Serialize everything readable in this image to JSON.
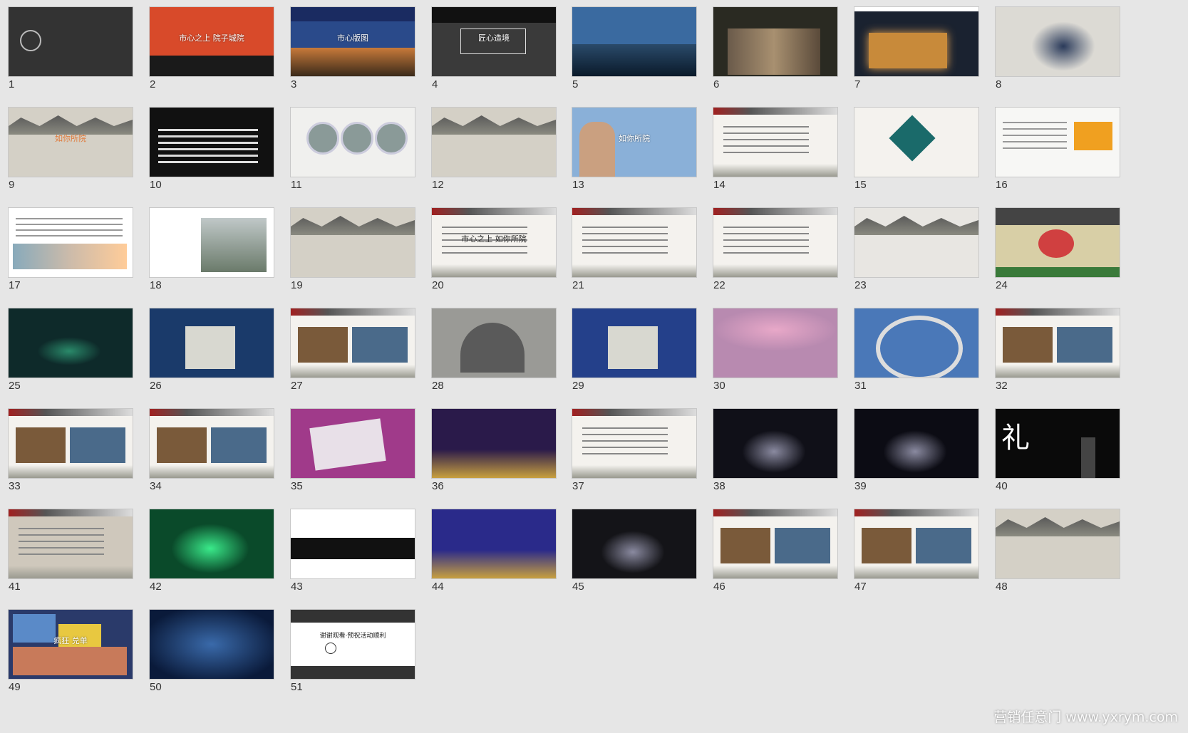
{
  "slides": [
    {
      "n": "1",
      "kind": "dark",
      "bg": "#333333",
      "title": ""
    },
    {
      "n": "2",
      "kind": "red",
      "bg": "#d84a2a",
      "title": "市心之上 院子城院"
    },
    {
      "n": "3",
      "kind": "city",
      "bg": "#2a4a8a",
      "title": "市心版图"
    },
    {
      "n": "4",
      "kind": "bw",
      "bg": "#3a3a3a",
      "title": "匠心造境"
    },
    {
      "n": "5",
      "kind": "sky",
      "bg": "#3a6aa0",
      "title": ""
    },
    {
      "n": "6",
      "kind": "people",
      "bg": "#2a2a22",
      "title": ""
    },
    {
      "n": "7",
      "kind": "house",
      "bg": "#1a2230",
      "title": ""
    },
    {
      "n": "8",
      "kind": "ink",
      "bg": "#dcdad4",
      "title": ""
    },
    {
      "n": "9",
      "kind": "wall",
      "bg": "#d4d0c6",
      "title": "如你所院"
    },
    {
      "n": "10",
      "kind": "black",
      "bg": "#111111",
      "title": ""
    },
    {
      "n": "11",
      "kind": "circles",
      "bg": "#f0f0ee",
      "title": ""
    },
    {
      "n": "12",
      "kind": "wall",
      "bg": "#d4d0c6",
      "title": ""
    },
    {
      "n": "13",
      "kind": "child",
      "bg": "#8ab0d8",
      "title": "如你所院"
    },
    {
      "n": "14",
      "kind": "doc",
      "bg": "#f4f2ee",
      "title": ""
    },
    {
      "n": "15",
      "kind": "diagram",
      "bg": "#f4f2ee",
      "title": ""
    },
    {
      "n": "16",
      "kind": "doc2",
      "bg": "#f7f7f5",
      "title": ""
    },
    {
      "n": "17",
      "kind": "doc3",
      "bg": "#ffffff",
      "title": ""
    },
    {
      "n": "18",
      "kind": "doc4",
      "bg": "#ffffff",
      "title": ""
    },
    {
      "n": "19",
      "kind": "wall",
      "bg": "#d4d0c6",
      "title": ""
    },
    {
      "n": "20",
      "kind": "doc",
      "bg": "#f4f2ee",
      "title": "市心之上 如你所院"
    },
    {
      "n": "21",
      "kind": "doc",
      "bg": "#f4f2ee",
      "title": ""
    },
    {
      "n": "22",
      "kind": "doc",
      "bg": "#f4f2ee",
      "title": ""
    },
    {
      "n": "23",
      "kind": "inkscape",
      "bg": "#e8e6e2",
      "title": ""
    },
    {
      "n": "24",
      "kind": "plan",
      "bg": "#d8cfa6",
      "title": ""
    },
    {
      "n": "25",
      "kind": "stage-green",
      "bg": "#0e2a2a",
      "title": ""
    },
    {
      "n": "26",
      "kind": "stage-blue",
      "bg": "#1a3a6a",
      "title": ""
    },
    {
      "n": "27",
      "kind": "doc-photo",
      "bg": "#f4f2ee",
      "title": ""
    },
    {
      "n": "28",
      "kind": "render",
      "bg": "#9a9a96",
      "title": ""
    },
    {
      "n": "29",
      "kind": "stage-blue",
      "bg": "#24408a",
      "title": ""
    },
    {
      "n": "30",
      "kind": "blossom",
      "bg": "#b88ab0",
      "title": ""
    },
    {
      "n": "31",
      "kind": "tunnel",
      "bg": "#4a78b8",
      "title": ""
    },
    {
      "n": "32",
      "kind": "doc-photo",
      "bg": "#f4f2ee",
      "title": ""
    },
    {
      "n": "33",
      "kind": "doc-photo",
      "bg": "#f4f2ee",
      "title": ""
    },
    {
      "n": "34",
      "kind": "doc-photo",
      "bg": "#f4f2ee",
      "title": ""
    },
    {
      "n": "35",
      "kind": "magenta",
      "bg": "#a03a8a",
      "title": ""
    },
    {
      "n": "36",
      "kind": "stage-purple",
      "bg": "#2a1a4a",
      "title": ""
    },
    {
      "n": "37",
      "kind": "doc",
      "bg": "#f4f2ee",
      "title": ""
    },
    {
      "n": "38",
      "kind": "dark-stage",
      "bg": "#101018",
      "title": ""
    },
    {
      "n": "39",
      "kind": "dark-stage",
      "bg": "#0c0c14",
      "title": ""
    },
    {
      "n": "40",
      "kind": "li",
      "bg": "#0a0a0a",
      "title": "礼"
    },
    {
      "n": "41",
      "kind": "doc-dark",
      "bg": "#cfc8bc",
      "title": ""
    },
    {
      "n": "42",
      "kind": "green-stage",
      "bg": "#0a4a2a",
      "title": ""
    },
    {
      "n": "43",
      "kind": "doc-black",
      "bg": "#ffffff",
      "title": ""
    },
    {
      "n": "44",
      "kind": "stage-purple",
      "bg": "#2a2a8a",
      "title": ""
    },
    {
      "n": "45",
      "kind": "dark-stage",
      "bg": "#141418",
      "title": ""
    },
    {
      "n": "46",
      "kind": "doc-photo",
      "bg": "#f4f2ee",
      "title": ""
    },
    {
      "n": "47",
      "kind": "doc-photo",
      "bg": "#f4f2ee",
      "title": ""
    },
    {
      "n": "48",
      "kind": "wall",
      "bg": "#d4d0c6",
      "title": ""
    },
    {
      "n": "49",
      "kind": "collage",
      "bg": "#2a3a6a",
      "title": "疯狂 兑单"
    },
    {
      "n": "50",
      "kind": "water",
      "bg": "#0a1a3a",
      "title": ""
    },
    {
      "n": "51",
      "kind": "end",
      "bg": "#ffffff",
      "title": "谢谢观看·预祝活动顺利"
    }
  ],
  "watermark": "营销任意门 www.yxrym.com"
}
